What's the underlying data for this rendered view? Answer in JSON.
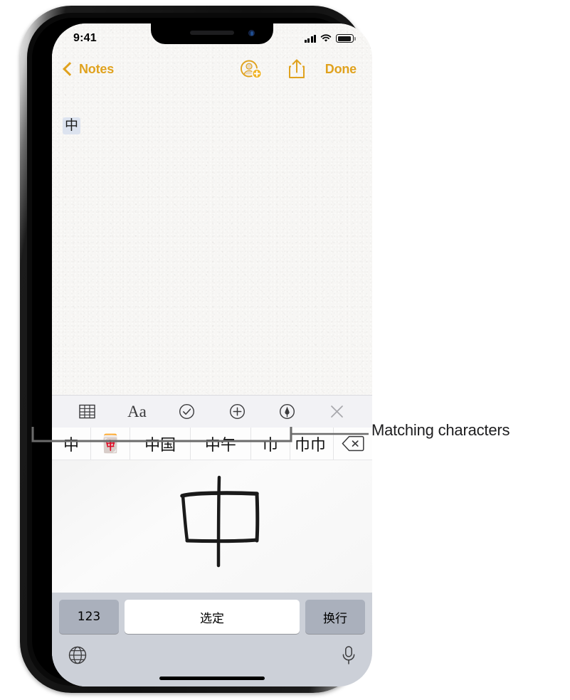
{
  "status_bar": {
    "time": "9:41",
    "cellular_icon": "signal-bars-icon",
    "wifi_icon": "wifi-icon",
    "battery_icon": "battery-icon"
  },
  "nav_bar": {
    "back_label": "Notes",
    "back_chevron_icon": "chevron-left-icon",
    "add_person_icon": "add-person-icon",
    "share_icon": "share-icon",
    "done_label": "Done",
    "accent_color": "#E0A21E"
  },
  "note": {
    "text": "中",
    "highlight_color": "#dce3ef"
  },
  "format_toolbar": {
    "items": [
      {
        "name": "table-icon",
        "label": ""
      },
      {
        "name": "text-format-icon",
        "label": "Aa"
      },
      {
        "name": "checklist-icon",
        "label": ""
      },
      {
        "name": "add-attachment-icon",
        "label": ""
      },
      {
        "name": "markup-pen-icon",
        "label": ""
      },
      {
        "name": "close-icon",
        "label": ""
      }
    ]
  },
  "candidate_bar": {
    "candidates": [
      {
        "text": "中",
        "type": "char"
      },
      {
        "text": "🀄",
        "type": "emoji"
      },
      {
        "text": "中国",
        "type": "word"
      },
      {
        "text": "中午",
        "type": "word"
      },
      {
        "text": "巾",
        "type": "char"
      },
      {
        "text": "巾巾",
        "type": "clipped"
      }
    ],
    "delete_icon": "delete-backward-icon"
  },
  "handwriting": {
    "drawn_character": "中",
    "hint": "handwritten-stroke-canvas"
  },
  "keyboard": {
    "numeric_key": "123",
    "space_key": "选定",
    "return_key": "换行",
    "globe_icon": "globe-icon",
    "dictation_icon": "microphone-icon"
  },
  "callout": {
    "label": "Matching characters",
    "line_color": "#6b6b6b"
  }
}
